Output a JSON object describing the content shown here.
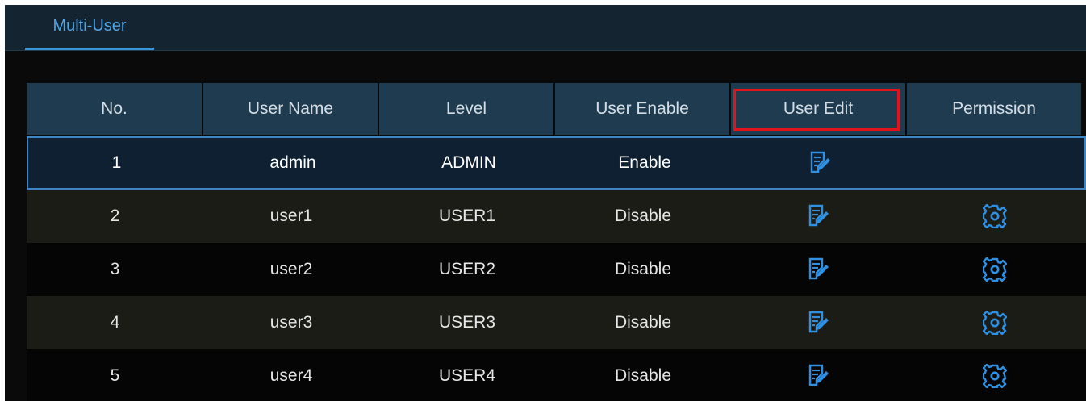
{
  "tabs": [
    {
      "label": "Multi-User",
      "active": true
    }
  ],
  "table": {
    "headers": [
      "No.",
      "User Name",
      "Level",
      "User Enable",
      "User Edit",
      "Permission"
    ],
    "rows": [
      {
        "no": "1",
        "user_name": "admin",
        "level": "ADMIN",
        "enable": "Enable",
        "edit_icon": "edit-icon",
        "permission_icon": ""
      },
      {
        "no": "2",
        "user_name": "user1",
        "level": "USER1",
        "enable": "Disable",
        "edit_icon": "edit-icon",
        "permission_icon": "gear-icon"
      },
      {
        "no": "3",
        "user_name": "user2",
        "level": "USER2",
        "enable": "Disable",
        "edit_icon": "edit-icon",
        "permission_icon": "gear-icon"
      },
      {
        "no": "4",
        "user_name": "user3",
        "level": "USER3",
        "enable": "Disable",
        "edit_icon": "edit-icon",
        "permission_icon": "gear-icon"
      },
      {
        "no": "5",
        "user_name": "user4",
        "level": "USER4",
        "enable": "Disable",
        "edit_icon": "edit-icon",
        "permission_icon": "gear-icon"
      }
    ],
    "selected_row": 0,
    "highlighted_column": "User Edit"
  },
  "colors": {
    "accent": "#3b95d9",
    "header_bg": "#1f3b4f",
    "highlight": "#e3121b",
    "selected_border": "#3e86c3",
    "icon_blue": "#2f8fe0"
  }
}
